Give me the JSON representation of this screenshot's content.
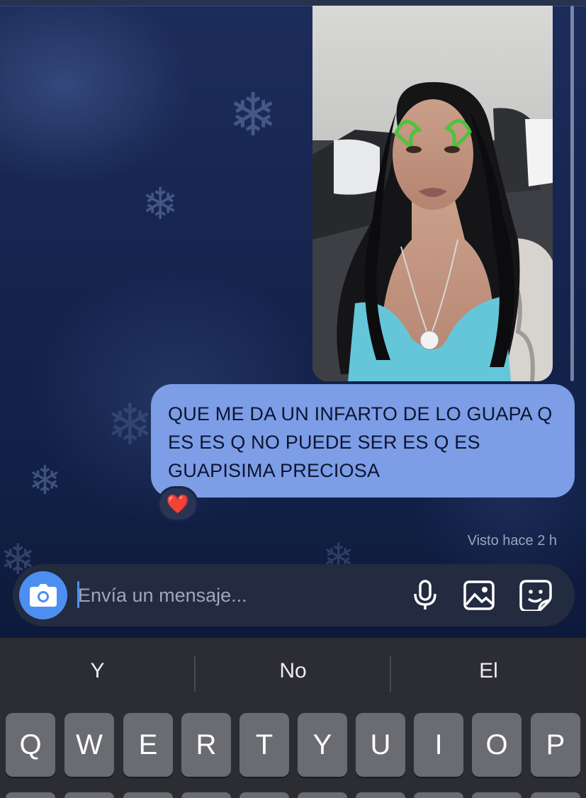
{
  "messages": {
    "photo": {
      "description": "selfie"
    },
    "text_bubble": {
      "text": "QUE ME DA UN INFARTO DE LO GUAPA Q ES ES Q NO PUEDE SER ES Q ES GUAPISIMA PRECIOSA",
      "reaction": "❤️"
    },
    "seen_status": "Visto hace 2 h"
  },
  "compose": {
    "placeholder": "Envía un mensaje...",
    "icons": [
      "camera-icon",
      "microphone-icon",
      "image-icon",
      "sticker-icon"
    ]
  },
  "keyboard": {
    "suggestions": [
      "Y",
      "No",
      "El"
    ],
    "row1": [
      "Q",
      "W",
      "E",
      "R",
      "T",
      "Y",
      "U",
      "I",
      "O",
      "P"
    ]
  },
  "colors": {
    "bubble": "#7d9de6",
    "camera_button": "#4d8ff0",
    "compose_bg": "#222b40",
    "keyboard_bg": "#2c2d32",
    "key_bg": "#6b6c72"
  }
}
